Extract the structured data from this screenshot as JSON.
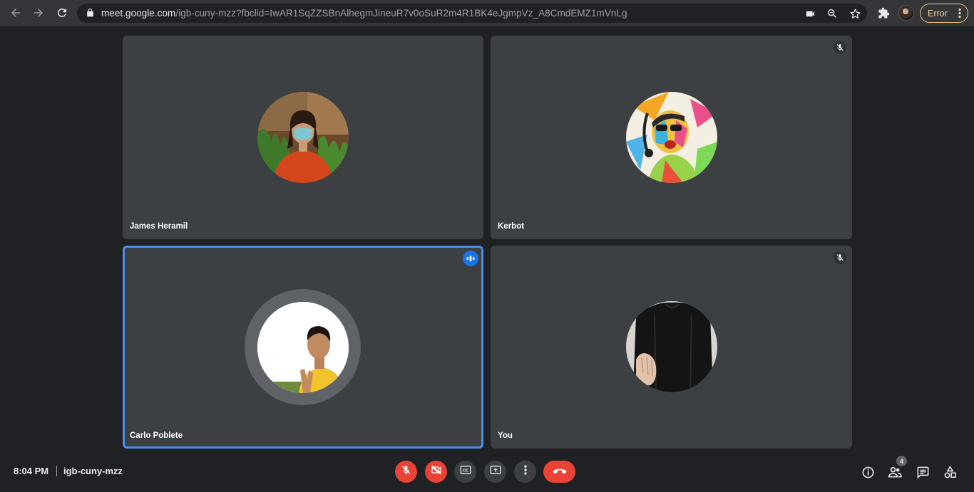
{
  "browser": {
    "url_host": "meet.google.com",
    "url_path": "/igb-cuny-mzz?fbclid=IwAR1SqZZSBnAlhegmJineuR7v0oSuR2m4R1BK4eJgmpVz_A8CmdEMZ1mVnLg",
    "profile_status": "Error",
    "icons": [
      "back-icon",
      "forward-icon",
      "reload-icon",
      "lock-icon",
      "camera-icon",
      "zoom-icon",
      "star-icon",
      "extensions-icon",
      "more-vert-icon"
    ]
  },
  "participants": [
    {
      "name": "James Heramil",
      "muted": false,
      "speaking": false
    },
    {
      "name": "Kerbot",
      "muted": true,
      "speaking": false
    },
    {
      "name": "Carlo Poblete",
      "muted": false,
      "speaking": true
    },
    {
      "name": "You",
      "muted": true,
      "speaking": false
    }
  ],
  "bottom_bar": {
    "time": "8:04 PM",
    "meeting_code": "igb-cuny-mzz",
    "people_count": "4",
    "controls": [
      "mic-off-icon",
      "camera-off-icon",
      "captions-icon",
      "present-icon",
      "more-options-icon",
      "leave-call-icon"
    ],
    "side_controls": [
      "info-icon",
      "people-icon",
      "chat-icon",
      "activities-icon"
    ]
  },
  "colors": {
    "background": "#202124",
    "tile": "#3c4043",
    "danger": "#ea4335",
    "active_speaker": "#4b8fe6",
    "error_pill": "#f2c776"
  }
}
